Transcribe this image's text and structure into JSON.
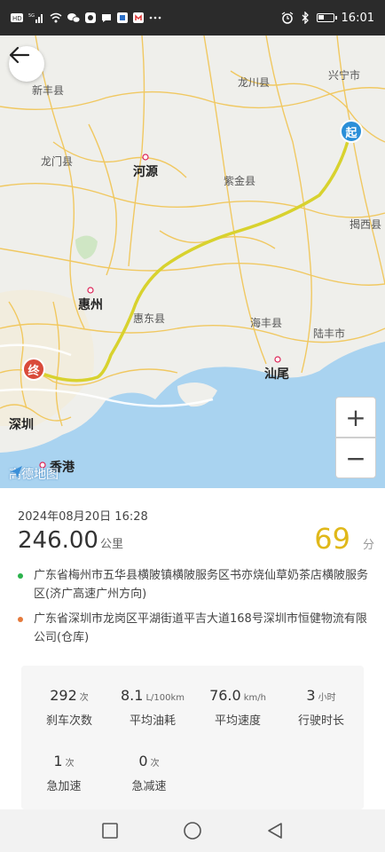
{
  "status_bar": {
    "left_icons": [
      "hd-icon",
      "signal-icon",
      "wifi-icon",
      "wechat-icon",
      "app-icon",
      "message-icon",
      "app-icon",
      "app-icon",
      "more-icon"
    ],
    "signal_label": "5G",
    "time": "16:01",
    "battery_level": 0.45
  },
  "map": {
    "labels": {
      "xinfeng": "新丰县",
      "longchuan": "龙川县",
      "xingning": "兴宁市",
      "longmen": "龙门县",
      "heyuan": "河源",
      "zijin": "紫金县",
      "jiexi": "揭西县",
      "huizhou": "惠州",
      "huidong": "惠东县",
      "haifeng": "海丰县",
      "lufeng": "陆丰市",
      "shanwei": "汕尾",
      "shenzhen": "深圳",
      "hongkong": "香港"
    },
    "start_marker": "起",
    "end_marker": "终",
    "zoom_in": "+",
    "zoom_out": "−",
    "logo_text": "高德地图",
    "colors": {
      "route": "#d8d22e",
      "water": "#a9d3f0",
      "land": "#efefeb",
      "road": "#f1c24a"
    }
  },
  "trip": {
    "date": "2024年08月20日 16:28",
    "distance_value": "246.00",
    "distance_unit": "公里",
    "score_value": "69",
    "score_unit": "分",
    "from_address": "广东省梅州市五华县横陂镇横陂服务区书亦烧仙草奶茶店横陂服务区(济广高速广州方向)",
    "to_address": "广东省深圳市龙岗区平湖街道平吉大道168号深圳市恒健物流有限公司(仓库)",
    "from_color": "#2bb24c",
    "to_color": "#e57a3c"
  },
  "stats": [
    {
      "value": "292",
      "unit": "次",
      "label": "刹车次数"
    },
    {
      "value": "8.1",
      "unit": "L/100km",
      "label": "平均油耗"
    },
    {
      "value": "76.0",
      "unit": "km/h",
      "label": "平均速度"
    },
    {
      "value": "3",
      "unit": "小时",
      "label": "行驶时长"
    },
    {
      "value": "1",
      "unit": "次",
      "label": "急加速"
    },
    {
      "value": "0",
      "unit": "次",
      "label": "急减速"
    }
  ]
}
